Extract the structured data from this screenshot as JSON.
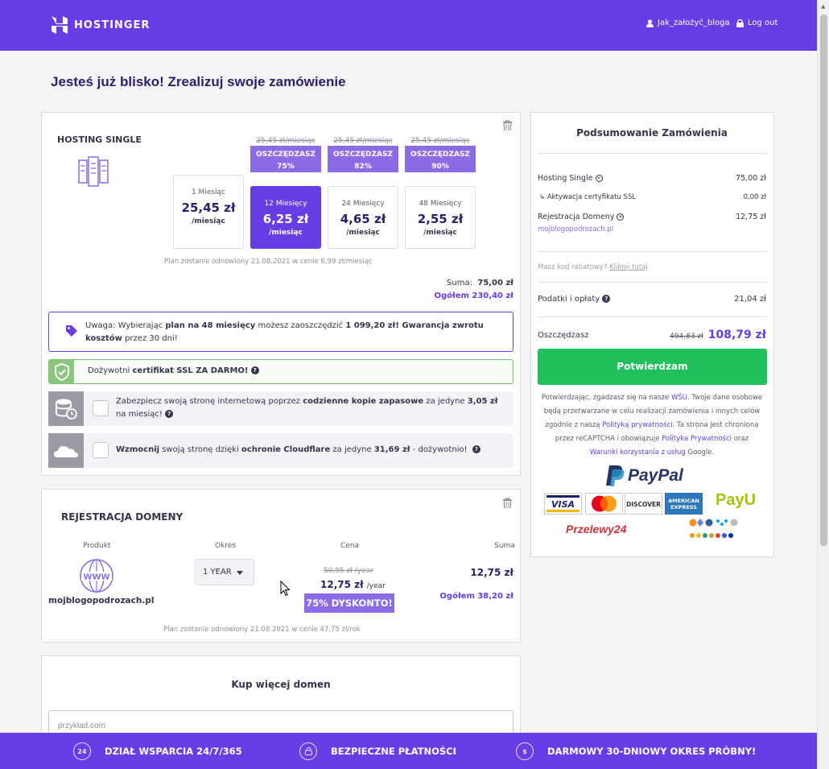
{
  "header": {
    "brand": "HOSTINGER",
    "user": "Jak_założyć_bloga",
    "logout": "Log out",
    "colors": {
      "brand": "#673de6"
    }
  },
  "page_title": "Jesteś już blisko! Zrealizuj swoje zamówienie",
  "hosting": {
    "plan_name": "HOSTING SINGLE",
    "options": [
      {
        "term": "1 Miesiąc",
        "price": "25,45 zł",
        "unit": "/miesiąc",
        "old_price": "",
        "save_label": "",
        "save_pct": "",
        "selected": false
      },
      {
        "term": "12 Miesięcy",
        "price": "6,25 zł",
        "unit": "/miesiąc",
        "old_price": "25,45 zł/miesiąc",
        "save_label": "OSZCZĘDZASZ",
        "save_pct": "75%",
        "selected": true
      },
      {
        "term": "24 Miesięcy",
        "price": "4,65 zł",
        "unit": "/miesiąc",
        "old_price": "25,45 zł/miesiąc",
        "save_label": "OSZCZĘDZASZ",
        "save_pct": "82%",
        "selected": false
      },
      {
        "term": "48 Miesięcy",
        "price": "2,55 zł",
        "unit": "/miesiąc",
        "old_price": "25,45 zł/miesiąc",
        "save_label": "OSZCZĘDZASZ",
        "save_pct": "90%",
        "selected": false
      }
    ],
    "renewal": "Plan zostanie odnowiony 21.08.2021 w cenie 6,99 zł/miesiąc",
    "sum_label": "Suma:",
    "sum_value": "75,00 zł",
    "total": "Ogółem 230,40 zł",
    "notice": {
      "p1": "Uwaga: Wybierając ",
      "b1": "plan na 48 miesięcy",
      "p2": " możesz zaoszczędzić ",
      "b2": "1 099,20 zł! Gwarancja zwrotu kosztów",
      "p3": " przez 30 dni!"
    },
    "ssl": {
      "p1": "Dożywotni ",
      "b1": "certifikat SSL ZA DARMO!"
    },
    "addons": [
      {
        "p1": "Zabezpiecz swoją stronę internetową poprzez ",
        "b1": "codzienne kopie zapasowe",
        "p2": " za jedyne ",
        "b2": "3,05 zł",
        "p3": " na miesiąc!"
      },
      {
        "b0": "Wzmocnij",
        "p1": " swoją stronę dzięki ",
        "b1": "ochronie Cloudflare",
        "p2": " za jedyne ",
        "b2": "31,69 zł",
        "p3": " - dożywotnio!"
      }
    ]
  },
  "domain": {
    "title": "REJESTRACJA DOMENY",
    "col_product": "Produkt",
    "col_period": "Okres",
    "col_price": "Cena",
    "col_sum": "Suma",
    "name": "mojblogopodrozach.pl",
    "period": "1 YEAR",
    "old_price": "50,95 zł /year",
    "price": "12,75 zł",
    "price_unit": "/year",
    "discount": "75% DYSKONTO!",
    "sum": "12,75 zł",
    "total": "Ogółem 38,20 zł",
    "renewal": "Plan zostanie odnowiony 21.08.2021 w cenie 47,75 zł/rok",
    "www_label": "WWW"
  },
  "more_domains": {
    "title": "Kup więcej domen",
    "placeholder": "przykład.com"
  },
  "summary": {
    "title": "Podsumowanie Zamówienia",
    "items": [
      {
        "label": "Hosting Single",
        "value": "75,00 zł"
      },
      {
        "label": "↳ Aktywacja certyfikatu SSL",
        "value": "0,00 zł"
      },
      {
        "label": "Rejestracja Domeny",
        "value": "12,75 zł",
        "sub": "mojblogopodrozach.pl"
      }
    ],
    "coupon_text": "Masz kod rabatowy?",
    "coupon_link": "Kliknij tutaj",
    "taxes_label": "Podatki i opłaty",
    "taxes_value": "21,04 zł",
    "savings_label": "Oszczędzasz",
    "savings_old": "494,83 zł",
    "savings_value": "108,79 zł",
    "confirm": "Potwierdzam",
    "legal": {
      "t1": "Potwierdzając, zgadzasz się na nasze ",
      "l1": "WŚU",
      "t2": ". Twoje dane osobowe będą przetwarzane w celu realizacji zamówienia i innych celów zgodnie z naszą ",
      "l2": "Polityką prywatności",
      "t3": ". Ta strona jest chroniona przez reCAPTCHA i obowiązuje ",
      "l3": "Polityka Prywatności",
      "t4": " oraz ",
      "l4": "Warunki korzystania z usług",
      "t5": " Google."
    },
    "payments": {
      "paypal": "PayPal",
      "visa": "VISA",
      "discover": "DISCOVER",
      "amex1": "AMERICAN",
      "amex2": "EXPRESS",
      "payu": "PayU",
      "przelewy": "Przelewy24"
    }
  },
  "footer": {
    "support": "DZIAŁ WSPARCIA 24/7/365",
    "support_icon": "24",
    "payments": "BEZPIECZNE PŁATNOŚCI",
    "trial": "DARMOWY 30-DNIOWY OKRES PRÓBNY!",
    "trial_icon": "$"
  }
}
